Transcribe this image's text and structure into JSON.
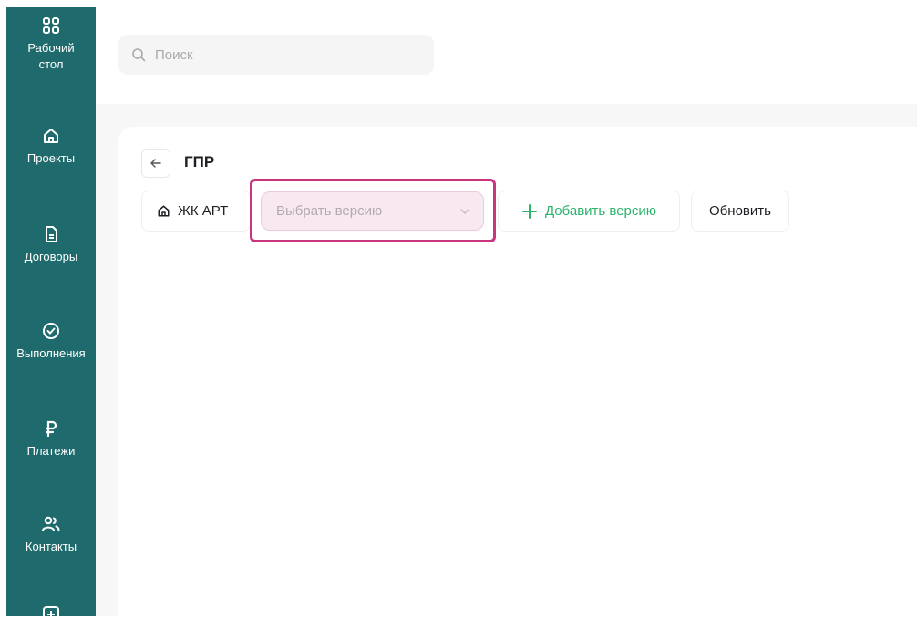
{
  "sidebar": {
    "items": [
      {
        "label": "Рабочий\nстол",
        "icon": "dashboard-grid-icon"
      },
      {
        "label": "Проекты",
        "icon": "home-icon"
      },
      {
        "label": "Договоры",
        "icon": "document-icon"
      },
      {
        "label": "Выполнения",
        "icon": "check-circle-icon"
      },
      {
        "label": "Платежи",
        "icon": "ruble-icon"
      },
      {
        "label": "Контакты",
        "icon": "contacts-icon"
      },
      {
        "label": "",
        "icon": "add-square-icon"
      }
    ]
  },
  "search": {
    "placeholder": "Поиск",
    "icon": "search-icon"
  },
  "page": {
    "title": "ГПР",
    "back_icon": "arrow-left-icon"
  },
  "toolbar": {
    "project_label": "ЖК АРТ",
    "version_placeholder": "Выбрать версию",
    "add_version_label": "Добавить версию",
    "refresh_label": "Обновить"
  },
  "colors": {
    "sidebar": "#1e6a6c",
    "accent_green": "#2db36c",
    "highlight": "#c9357f",
    "select_bg": "#f8e9f1"
  }
}
